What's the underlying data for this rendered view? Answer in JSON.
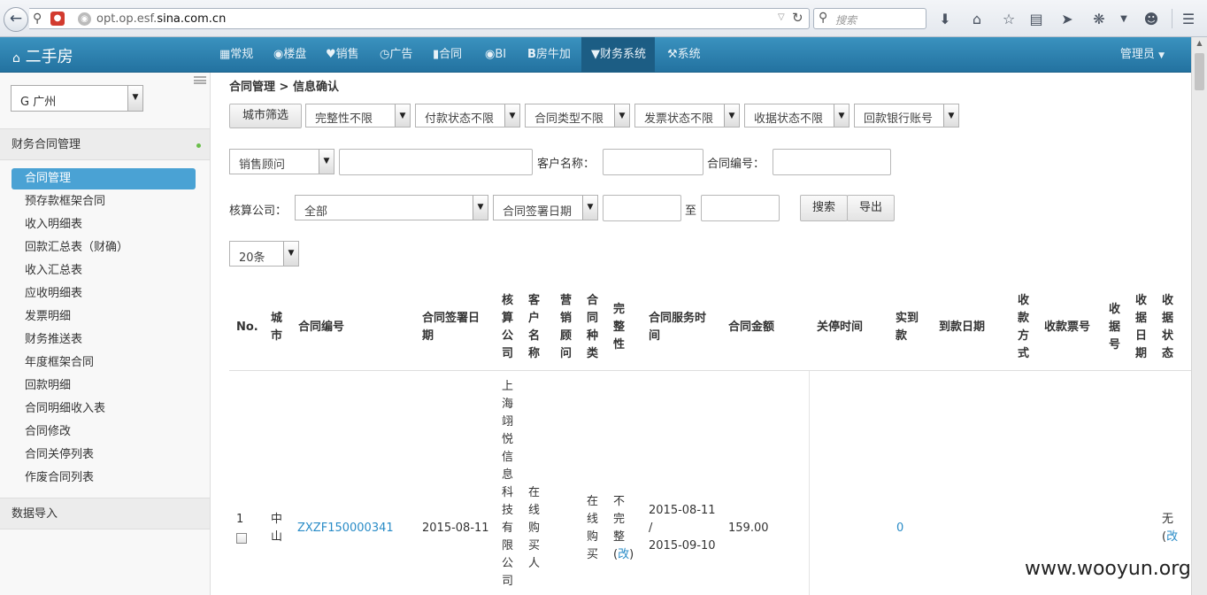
{
  "browser": {
    "url_prefix": "opt.op.esf.",
    "url_domain": "sina.com.cn",
    "search_placeholder": "搜索"
  },
  "navbar": {
    "brand": "二手房",
    "items": [
      {
        "label": "常规",
        "icon": "grid-icon"
      },
      {
        "label": "楼盘",
        "icon": "globe-icon"
      },
      {
        "label": "销售",
        "icon": "heart-icon"
      },
      {
        "label": "广告",
        "icon": "clock-icon"
      },
      {
        "label": "合同",
        "icon": "document-icon"
      },
      {
        "label": "BI",
        "icon": "eye-icon"
      },
      {
        "label": "房牛加",
        "icon": "b-icon"
      },
      {
        "label": "财务系统",
        "icon": "filter-icon"
      },
      {
        "label": "系统",
        "icon": "wrench-icon"
      }
    ],
    "active_index": 7,
    "admin_label": "管理员"
  },
  "sidebar": {
    "city": "G 广州",
    "section1": "财务合同管理",
    "items": [
      "合同管理",
      "预存款框架合同",
      "收入明细表",
      "回款汇总表（财确）",
      "收入汇总表",
      "应收明细表",
      "发票明细",
      "财务推送表",
      "年度框架合同",
      "回款明细",
      "合同明细收入表",
      "合同修改",
      "合同关停列表",
      "作废合同列表"
    ],
    "active_index": 0,
    "section2": "数据导入"
  },
  "main": {
    "breadcrumb": "合同管理 > 信息确认",
    "filters_row1": {
      "city_button": "城市筛选",
      "dropdowns": [
        "完整性不限",
        "付款状态不限",
        "合同类型不限",
        "发票状态不限",
        "收据状态不限",
        "回款银行账号"
      ]
    },
    "filters_row2": {
      "person_select": "销售顾问",
      "customer_label": "客户名称：",
      "contract_no_label": "合同编号："
    },
    "filters_row3": {
      "company_label": "核算公司：",
      "company_value": "全部",
      "date_type": "合同签署日期",
      "to_label": "至",
      "search_button": "搜索",
      "export_button": "导出"
    },
    "page_size": "20条",
    "table": {
      "headers": {
        "no": "No.",
        "city": "城市",
        "contract_no": "合同编号",
        "sign_date": "合同签署日期",
        "company": "核算公司",
        "customer": "客户名称",
        "advisor": "营销顾问",
        "contract_type": "合同种类",
        "completeness": "完整性",
        "service_time": "合同服务时间",
        "amount": "合同金额",
        "close_time": "关停时间",
        "received": "实到款",
        "arrival_date": "到款日期",
        "pay_method": "收款方式",
        "invoice_no": "收款票号",
        "receipt_no": "收据号",
        "receipt_date": "收据日期",
        "receipt_status": "收据状态"
      },
      "rows": [
        {
          "no": "1",
          "city": "中山",
          "contract_no": "ZXZF150000341",
          "sign_date": "2015-08-11",
          "company": "上海翊悦信息科技有限公司",
          "customer": "在线购买人",
          "contract_type": "在线购买",
          "completeness": "不完整",
          "completeness_link": "改",
          "service_start": "2015-08-11",
          "service_sep": "/",
          "service_end": "2015-09-10",
          "amount": "159.00",
          "received": "0",
          "receipt_status": "无",
          "receipt_link": "改"
        }
      ]
    }
  },
  "watermark": "www.wooyun.org"
}
